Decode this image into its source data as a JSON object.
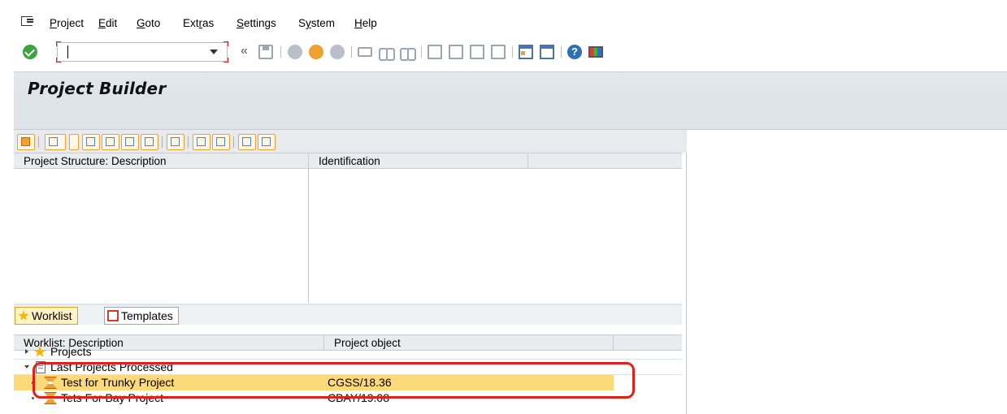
{
  "menu": {
    "items": [
      {
        "label": "Project",
        "mnemonic": "P"
      },
      {
        "label": "Edit",
        "mnemonic": "E"
      },
      {
        "label": "Goto",
        "mnemonic": "G"
      },
      {
        "label": "Extras",
        "mnemonic": "r"
      },
      {
        "label": "Settings",
        "mnemonic": "S"
      },
      {
        "label": "System",
        "mnemonic": "y"
      },
      {
        "label": "Help",
        "mnemonic": "H"
      }
    ]
  },
  "toolbar": {
    "command_value": "",
    "chevron": "«",
    "help_glyph": "?"
  },
  "title": "Project Builder",
  "structure_grid": {
    "columns": [
      "Project Structure: Description",
      "Identification"
    ]
  },
  "tabs": [
    {
      "label": "Worklist",
      "active": true,
      "icon": "star-icon"
    },
    {
      "label": "Templates",
      "active": false,
      "icon": "template-icon"
    }
  ],
  "worklist_grid": {
    "columns": [
      "Worklist: Description",
      "Project object"
    ],
    "rows": [
      {
        "description": "Projects",
        "object": "",
        "icon": "star-icon",
        "expanded": false
      },
      {
        "description": "Last Projects Processed",
        "object": "",
        "icon": "document-icon",
        "expanded": true
      },
      {
        "description": "Test for Trunky Project",
        "object": "CGSS/18.36",
        "icon": "project-icon",
        "selected": true
      },
      {
        "description": "Tets For Bay Project",
        "object": "CBAY/19.08",
        "icon": "project-icon",
        "selected": false
      }
    ]
  },
  "colors": {
    "selection": "#fcd97a",
    "highlight_border": "#e0201a",
    "header_bg": "#e3e8ed"
  }
}
